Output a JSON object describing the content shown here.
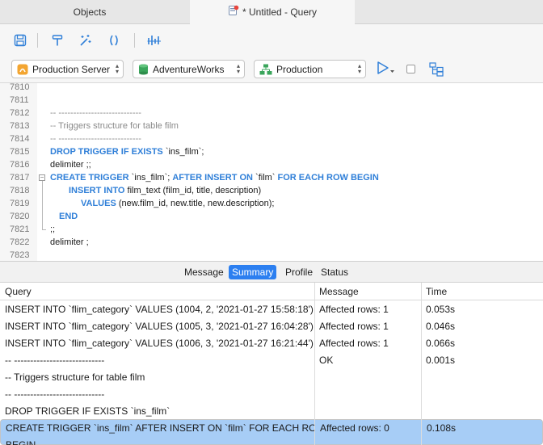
{
  "tabs": {
    "objects": "Objects",
    "query": "* Untitled - Query"
  },
  "toolbar": {
    "icons": [
      "save-icon",
      "format-icon",
      "beautify-icon",
      "code-wrap-icon",
      "explain-icon"
    ]
  },
  "selectors": {
    "connection": "Production Server",
    "database": "AdventureWorks",
    "schema": "Production"
  },
  "editor": {
    "line_numbers": [
      "7810",
      "7811",
      "7812",
      "7813",
      "7814",
      "7815",
      "7816",
      "7817",
      "7818",
      "7819",
      "7820",
      "7821",
      "7822",
      "7823"
    ],
    "l7812": "-- ----------------------------",
    "l7813": "-- Triggers structure for table film",
    "l7814": "-- ----------------------------",
    "l7815_kw": "DROP TRIGGER IF EXISTS",
    "l7815_rest": " `ins_film`;",
    "l7816": "delimiter ;;",
    "l7817_kw1": "CREATE TRIGGER",
    "l7817_mid1": " `ins_film`; ",
    "l7817_kw2": "AFTER INSERT ON",
    "l7817_mid2": " `film` ",
    "l7817_kw3": "FOR EACH ROW BEGIN",
    "l7818_kw": "INSERT INTO",
    "l7818_rest": " film_text (film_id, title, description)",
    "l7819_kw": "VALUES",
    "l7819_rest": " (new.film_id, new.title, new.description);",
    "l7820_kw": "END",
    "l7821": ";;",
    "l7822": "delimiter ;"
  },
  "result_tabs": [
    "Message",
    "Summary",
    "Profile",
    "Status"
  ],
  "results": {
    "headers": [
      "Query",
      "Message",
      "Time"
    ],
    "rows": [
      {
        "query": "INSERT INTO `flim_category` VALUES (1004, 2, '2021-01-27 15:58:18')",
        "message": "Affected rows: 1",
        "time": "0.053s"
      },
      {
        "query": "INSERT INTO `flim_category` VALUES (1005, 3, '2021-01-27 16:04:28')",
        "message": "Affected rows: 1",
        "time": "0.046s"
      },
      {
        "query": "INSERT INTO `flim_category` VALUES (1006, 3, '2021-01-27 16:21:44')",
        "message": "Affected rows: 1",
        "time": "0.066s"
      },
      {
        "query": "-- ----------------------------",
        "message": "OK",
        "time": "0.001s"
      },
      {
        "query": "-- Triggers structure for table film",
        "message": "",
        "time": ""
      },
      {
        "query": "-- ----------------------------",
        "message": "",
        "time": ""
      },
      {
        "query": "DROP TRIGGER IF EXISTS `ins_film`",
        "message": "",
        "time": ""
      },
      {
        "query": "CREATE TRIGGER `ins_film` AFTER INSERT ON `film` FOR EACH ROW",
        "message": "Affected rows: 0",
        "time": "0.108s"
      },
      {
        "query": "BEGIN",
        "message": "",
        "time": ""
      }
    ]
  },
  "colors": {
    "keyword": "#2f7fd8",
    "comment": "#8a8a8a",
    "active_tab": "#2c7ff0",
    "selected_row": "#a7cdf6"
  }
}
